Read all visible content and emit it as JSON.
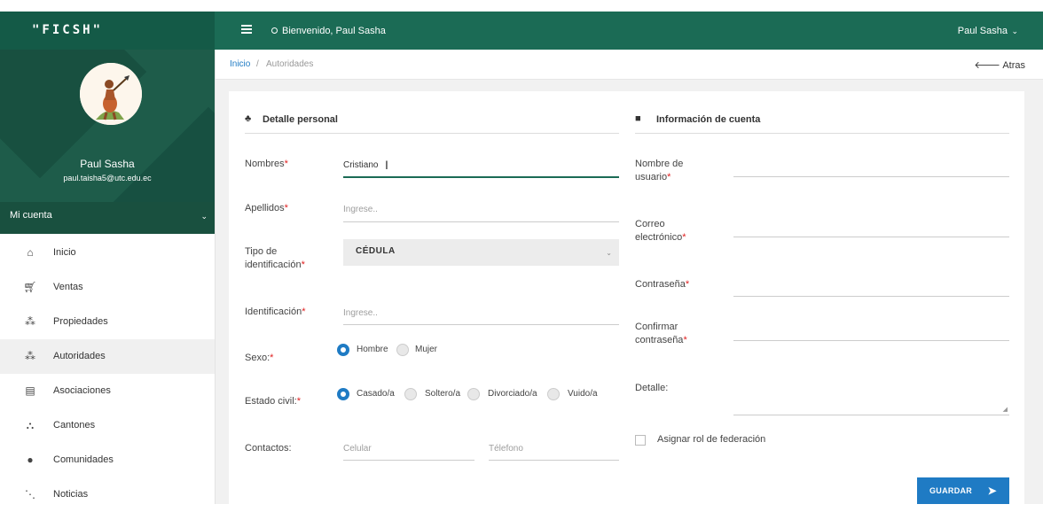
{
  "app": {
    "brand": "\"FICSH\""
  },
  "header": {
    "welcome": "Bienvenido, Paul Sasha",
    "user": "Paul Sasha"
  },
  "profile": {
    "name": "Paul Sasha",
    "email": "paul.taisha5@utc.edu.ec",
    "account_menu": "Mi cuenta"
  },
  "sidebar": {
    "items": [
      {
        "label": "Inicio",
        "icon": "home-icon"
      },
      {
        "label": "Ventas",
        "icon": "cart-icon"
      },
      {
        "label": "Propiedades",
        "icon": "users-icon"
      },
      {
        "label": "Autoridades",
        "icon": "users-icon"
      },
      {
        "label": "Asociaciones",
        "icon": "building-icon"
      },
      {
        "label": "Cantones",
        "icon": "group-icon"
      },
      {
        "label": "Comunidades",
        "icon": "map-pin-icon"
      },
      {
        "label": "Noticias",
        "icon": "rss-icon"
      }
    ]
  },
  "breadcrumb": {
    "home": "Inicio",
    "separator": "/",
    "current": "Autoridades",
    "back": "Atras"
  },
  "personal": {
    "title": "Detalle personal",
    "nombres_label": "Nombres",
    "nombres_value": "Cristiano",
    "apellidos_label": "Apellidos",
    "apellidos_placeholder": "Ingrese..",
    "tipo_label_1": "Tipo de",
    "tipo_label_2": "identificación",
    "tipo_value": "CÉDULA",
    "identificacion_label": "Identificación",
    "identificacion_placeholder": "Ingrese..",
    "sexo_label": "Sexo:",
    "sexo_options": [
      "Hombre",
      "Mujer"
    ],
    "estado_label": "Estado civil:",
    "estado_options": [
      "Casado/a",
      "Soltero/a",
      "Divorciado/a",
      "Vuido/a"
    ],
    "contactos_label": "Contactos:",
    "celular_placeholder": "Celular",
    "telefono_placeholder": "Télefono"
  },
  "account": {
    "title": "Información de cuenta",
    "usuario_label_1": "Nombre de",
    "usuario_label_2": "usuario",
    "correo_label_1": "Correo",
    "correo_label_2": "electrónico",
    "contrasena_label": "Contraseña",
    "confirmar_label_1": "Confirmar",
    "confirmar_label_2": "contraseña",
    "detalle_label": "Detalle:",
    "federacion_label": "Asignar rol de federación",
    "save_label": "GUARDAR"
  },
  "colors": {
    "header": "#1b6b55",
    "accent": "#1f7bc4",
    "required": "#e02020"
  }
}
